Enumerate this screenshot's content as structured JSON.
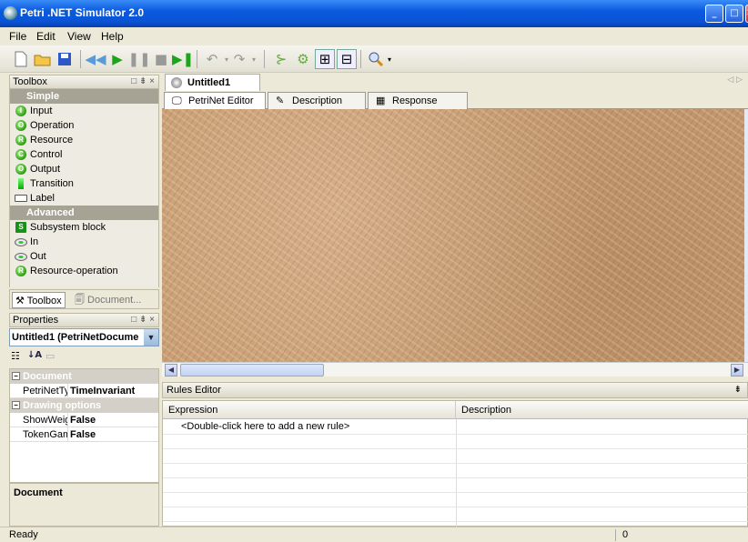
{
  "window": {
    "title": "Petri .NET Simulator 2.0",
    "minimize": "_",
    "maximize": "□",
    "close": "✕"
  },
  "menu": [
    "File",
    "Edit",
    "View",
    "Help"
  ],
  "toolbox": {
    "title": "Toolbox",
    "controls": "□ ⇟ ×",
    "groups": [
      {
        "label": "Simple",
        "items": [
          {
            "label": "Input",
            "badge": "I"
          },
          {
            "label": "Operation",
            "badge": "O"
          },
          {
            "label": "Resource",
            "badge": "R"
          },
          {
            "label": "Control",
            "badge": "C"
          },
          {
            "label": "Output",
            "badge": "O"
          },
          {
            "label": "Transition",
            "badge": ""
          },
          {
            "label": "Label",
            "badge": ""
          }
        ]
      },
      {
        "label": "Advanced",
        "items": [
          {
            "label": "Subsystem block",
            "badge": "S"
          },
          {
            "label": "In",
            "badge": ""
          },
          {
            "label": "Out",
            "badge": ""
          },
          {
            "label": "Resource-operation",
            "badge": "R"
          }
        ]
      }
    ],
    "bottom_tabs": [
      "Toolbox",
      "Document..."
    ]
  },
  "properties": {
    "title": "Properties",
    "controls": "□ ⇟ ×",
    "selected_object": "Untitled1 (PetriNetDocume",
    "categories": [
      {
        "label": "Document",
        "rows": [
          {
            "key": "PetriNetTyp",
            "value": "TimeInvariant"
          }
        ]
      },
      {
        "label": "Drawing options",
        "rows": [
          {
            "key": "ShowWeigh",
            "value": "False"
          },
          {
            "key": "TokenGam",
            "value": "False"
          }
        ]
      }
    ],
    "description_title": "Document"
  },
  "document": {
    "tab": "Untitled1",
    "nav": "◁ ▷",
    "subtabs": [
      "PetriNet Editor",
      "Description",
      "Response"
    ]
  },
  "rules": {
    "title": "Rules Editor",
    "pin": "⇟",
    "columns": [
      "Expression",
      "Description"
    ],
    "placeholder": "<Double-click here to add a new rule>"
  },
  "status": {
    "text": "Ready",
    "count": "0"
  }
}
